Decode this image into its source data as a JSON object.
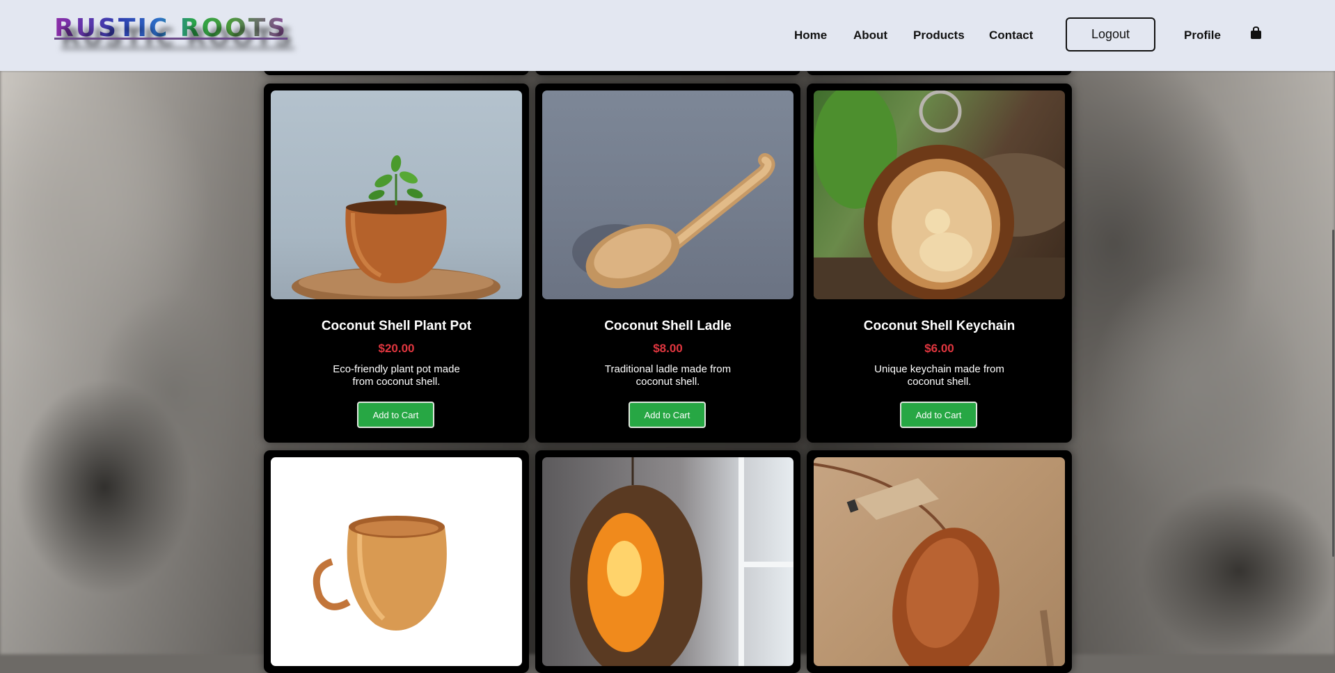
{
  "header": {
    "logo": "RUSTIC ROOTS",
    "nav": {
      "home": "Home",
      "about": "About",
      "products": "Products",
      "contact": "Contact",
      "logout": "Logout",
      "profile": "Profile",
      "cart_icon": "shopping-bag-icon"
    }
  },
  "products": [
    {
      "name": "Coconut Shell Plant Pot",
      "price": "$20.00",
      "description": "Eco-friendly plant pot made from coconut shell.",
      "button": "Add to Cart",
      "image": "plant-pot-image"
    },
    {
      "name": "Coconut Shell Ladle",
      "price": "$8.00",
      "description": "Traditional ladle made from coconut shell.",
      "button": "Add to Cart",
      "image": "ladle-image"
    },
    {
      "name": "Coconut Shell Keychain",
      "price": "$6.00",
      "description": "Unique keychain made from coconut shell.",
      "button": "Add to Cart",
      "image": "keychain-image"
    },
    {
      "image": "cup-image"
    },
    {
      "image": "hanging-lamp-image"
    },
    {
      "image": "pendant-image"
    }
  ],
  "colors": {
    "header_bg": "#e3e7f1",
    "card_bg": "#000000",
    "price": "#e0363f",
    "button_bg": "#27a744"
  }
}
